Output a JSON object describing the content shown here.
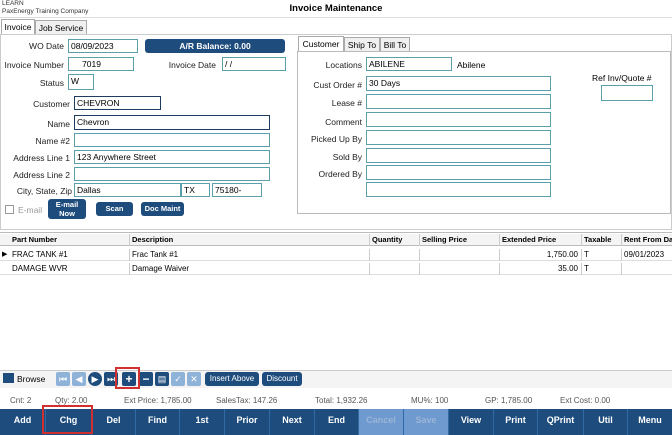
{
  "app": {
    "line1": "LEARN",
    "line2": "PaxEnergy Training Company"
  },
  "window_title": "Invoice Maintenance",
  "tabs": [
    {
      "label": "Invoice"
    },
    {
      "label": "Job Service"
    }
  ],
  "form": {
    "wo_date_label": "WO Date",
    "wo_date": "08/09/2023",
    "ar_balance": "A/R Balance:  0.00",
    "invoice_number_label": "Invoice Number",
    "invoice_number": "7019",
    "invoice_date_label": "Invoice Date",
    "invoice_date": " /  /",
    "status_label": "Status",
    "status": "W",
    "customer_label": "Customer",
    "customer": "CHEVRON",
    "name_label": "Name",
    "name": "Chevron",
    "name2_label": "Name #2",
    "name2": "",
    "addr1_label": "Address Line 1",
    "addr1": "123 Anywhere Street",
    "addr2_label": "Address Line 2",
    "addr2": "",
    "csz_label": "City, State, Zip",
    "city": "Dallas",
    "state": "TX",
    "zip": "75180-",
    "email_label": "E-mail",
    "email_now": "E-mail Now",
    "scan": "Scan",
    "doc_maint": "Doc Maint"
  },
  "subtabs": [
    {
      "label": "Customer"
    },
    {
      "label": "Ship To"
    },
    {
      "label": "Bill To"
    }
  ],
  "customer_panel": {
    "locations_label": "Locations",
    "locations": "ABILENE",
    "locations_text": "Abilene",
    "cust_order_label": "Cust Order #",
    "cust_order": "30 Days",
    "lease_label": "Lease #",
    "lease": "",
    "comment_label": "Comment",
    "comment": "",
    "picked_up_label": "Picked Up By",
    "picked_up": "",
    "sold_by_label": "Sold By",
    "sold_by": "",
    "ordered_by_label": "Ordered By",
    "ordered_by": "",
    "ref_label": "Ref Inv/Quote #",
    "ref": ""
  },
  "grid": {
    "columns": [
      "Part Number",
      "Description",
      "Quantity",
      "Selling Price",
      "Extended Price",
      "Taxable",
      "Rent From Da"
    ],
    "rows": [
      {
        "part": "FRAC TANK #1",
        "desc": "Frac Tank #1",
        "qty": "",
        "price": "",
        "ext": "1,750.00",
        "tax": "T",
        "rent": "09/01/2023"
      },
      {
        "part": "DAMAGE WVR",
        "desc": "Damage Waiver",
        "qty": "",
        "price": "",
        "ext": "35.00",
        "tax": "T",
        "rent": ""
      }
    ]
  },
  "nav": {
    "browse": "Browse",
    "insert_above": "Insert Above",
    "discount": "Discount"
  },
  "status": {
    "cnt": "Cnt: 2",
    "qty": "Qty: 2.00",
    "ext_price": "Ext Price: 1,785.00",
    "sales_tax": "SalesTax:    147.26",
    "total": "Total:  1,932.26",
    "mu": "MU%: 100",
    "gp": "GP:  1,785.00",
    "ext_cost": "Ext Cost: 0.00"
  },
  "buttons": [
    "Add",
    "Chg",
    "Del",
    "Find",
    "1st",
    "Prior",
    "Next",
    "End",
    "Cancel",
    "Save",
    "View",
    "Print",
    "QPrint",
    "Util",
    "Menu"
  ]
}
